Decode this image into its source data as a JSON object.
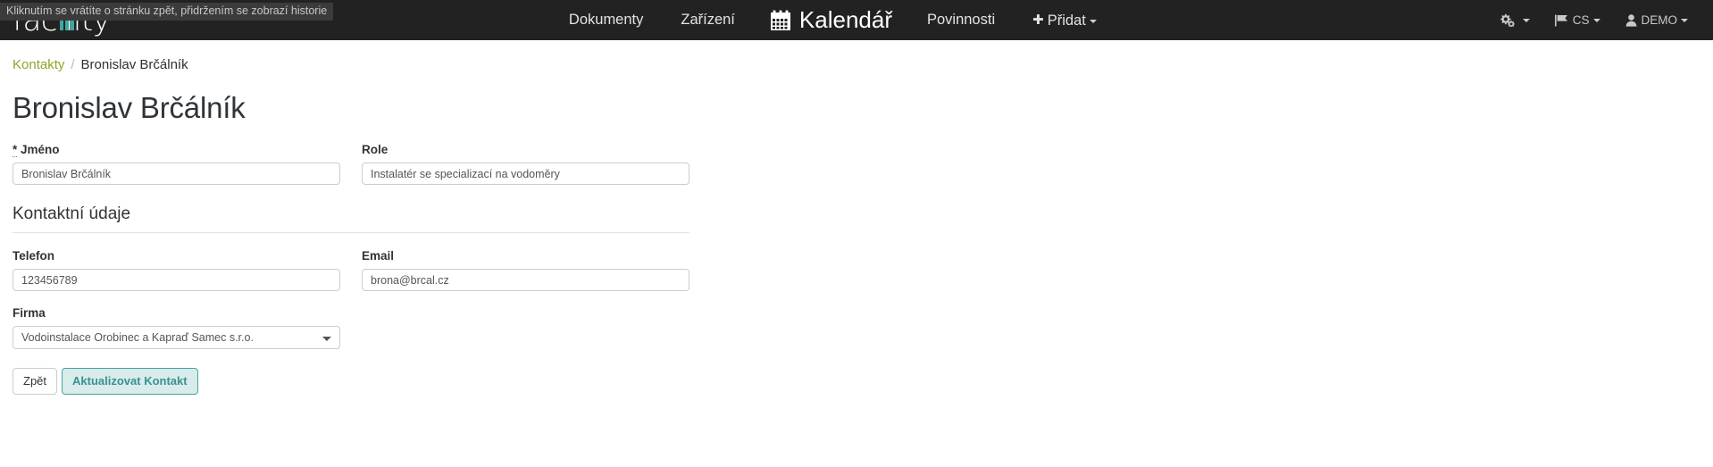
{
  "browser": {
    "status_tooltip": "Kliknutím se vrátíte o stránku zpět, přidržením se zobrazí historie"
  },
  "navbar": {
    "brand": "facility",
    "brand_icon": "bar-chart-icon",
    "background_color": "#222222",
    "items": [
      {
        "label": "Dokumenty",
        "icon": null
      },
      {
        "label": "Zařízení",
        "icon": null
      },
      {
        "label": "Kalendář",
        "icon": "calendar-icon",
        "active": true
      },
      {
        "label": "Povinnosti",
        "icon": null
      },
      {
        "label": "Přidat",
        "icon": "plus-icon",
        "caret": true
      }
    ],
    "right_items": [
      {
        "label": "",
        "icon": "gears-icon",
        "caret": true
      },
      {
        "label": "CS",
        "icon": "flag-icon",
        "caret": true
      },
      {
        "label": "DEMO",
        "icon": "user-icon",
        "caret": true
      }
    ]
  },
  "breadcrumb": {
    "parent_label": "Kontakty",
    "separator": "/",
    "current_label": "Bronislav Brčálník",
    "link_color": "#8ca528"
  },
  "page": {
    "title": "Bronislav Brčálník"
  },
  "form": {
    "name": {
      "required_marker": "*",
      "label": "Jméno",
      "value": "Bronislav Brčálník"
    },
    "role": {
      "label": "Role",
      "value": "Instalatér se specializací na vodoměry"
    },
    "contact_section_title": "Kontaktní údaje",
    "phone": {
      "label": "Telefon",
      "value": "123456789"
    },
    "email": {
      "label": "Email",
      "value": "brona@brcal.cz"
    },
    "company": {
      "label": "Firma",
      "selected": "Vodoinstalace Orobinec a Kapraď Samec s.r.o.",
      "options": [
        "Vodoinstalace Orobinec a Kapraď Samec s.r.o."
      ]
    },
    "buttons": {
      "back_label": "Zpět",
      "submit_label": "Aktualizovat Kontakt",
      "submit_bg": "#d9ebea",
      "submit_border": "#42a5a0",
      "submit_color": "#37938f"
    }
  }
}
